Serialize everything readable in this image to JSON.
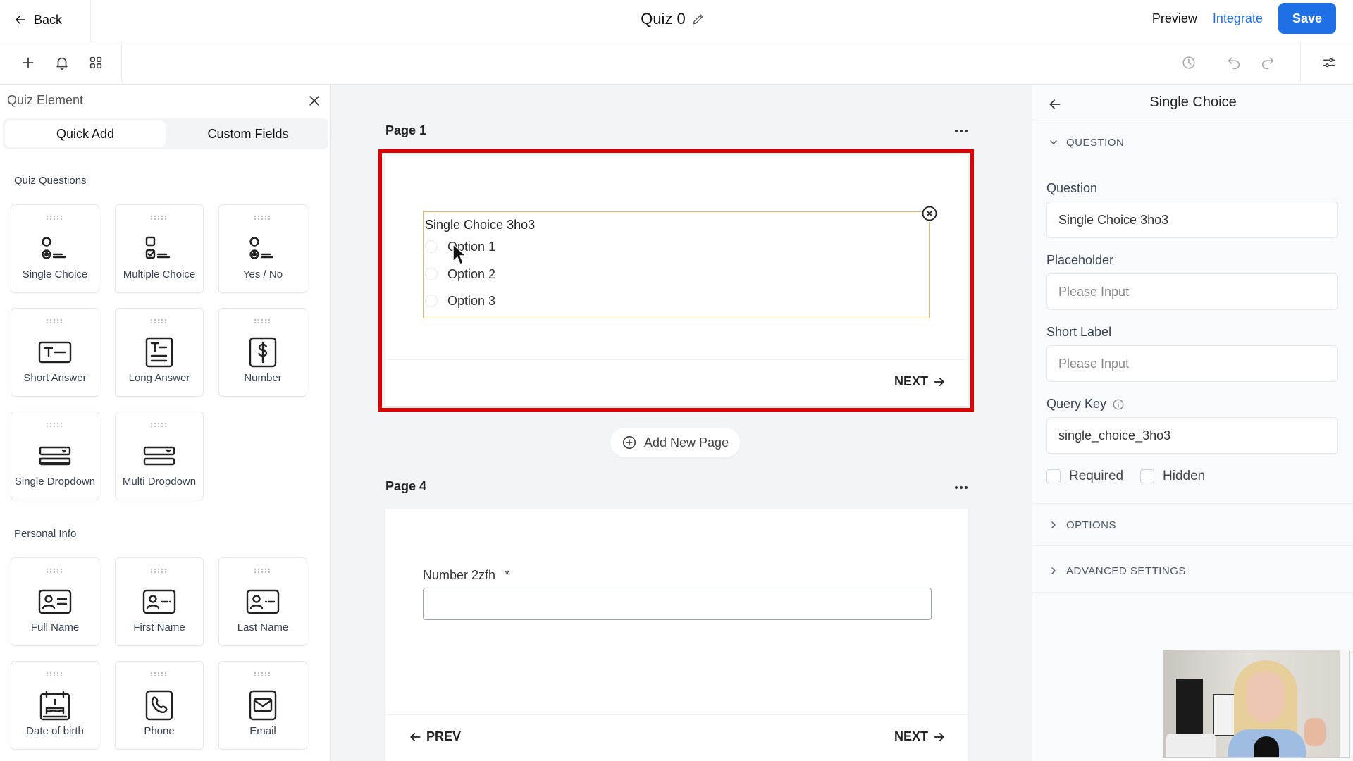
{
  "header": {
    "back_label": "Back",
    "title": "Quiz 0",
    "preview_label": "Preview",
    "integrate_label": "Integrate",
    "save_label": "Save"
  },
  "toolbar": {
    "left_icons": [
      "plus-icon",
      "bell-icon",
      "grid-icon"
    ],
    "right_icons": [
      "history-icon",
      "undo-icon",
      "redo-icon",
      "settings-sliders-icon"
    ]
  },
  "left_panel": {
    "title": "Quiz Element",
    "tabs": [
      {
        "label": "Quick Add",
        "active": true
      },
      {
        "label": "Custom Fields",
        "active": false
      }
    ],
    "sections": [
      {
        "label": "Quiz Questions",
        "items": [
          {
            "label": "Single Choice",
            "icon": "single-choice-icon"
          },
          {
            "label": "Multiple Choice",
            "icon": "multiple-choice-icon"
          },
          {
            "label": "Yes / No",
            "icon": "yes-no-icon"
          },
          {
            "label": "Short Answer",
            "icon": "short-answer-icon"
          },
          {
            "label": "Long Answer",
            "icon": "long-answer-icon"
          },
          {
            "label": "Number",
            "icon": "dollar-icon"
          },
          {
            "label": "Single Dropdown",
            "icon": "dropdown-icon"
          },
          {
            "label": "Multi Dropdown",
            "icon": "dropdown-icon"
          }
        ]
      },
      {
        "label": "Personal Info",
        "items": [
          {
            "label": "Full Name",
            "icon": "id-card-icon"
          },
          {
            "label": "First Name",
            "icon": "id-card-icon"
          },
          {
            "label": "Last Name",
            "icon": "id-card-icon"
          },
          {
            "label": "Date of birth",
            "icon": "cake-icon"
          },
          {
            "label": "Phone",
            "icon": "phone-icon"
          },
          {
            "label": "Email",
            "icon": "email-icon"
          }
        ]
      }
    ]
  },
  "canvas": {
    "page1": {
      "label": "Page 1",
      "question": {
        "title": "Single Choice 3ho3",
        "options": [
          "Option 1",
          "Option 2",
          "Option 3"
        ]
      },
      "next_label": "NEXT"
    },
    "add_page_label": "Add New Page",
    "page4": {
      "label": "Page 4",
      "field_label": "Number 2zfh",
      "required_mark": "*",
      "prev_label": "PREV",
      "next_label": "NEXT"
    }
  },
  "right_panel": {
    "title": "Single Choice",
    "question_section": "QUESTION",
    "question_label": "Question",
    "question_value": "Single Choice 3ho3",
    "placeholder_label": "Placeholder",
    "placeholder_placeholder": "Please Input",
    "short_label_label": "Short Label",
    "short_label_placeholder": "Please Input",
    "query_key_label": "Query Key",
    "query_key_value": "single_choice_3ho3",
    "required_label": "Required",
    "hidden_label": "Hidden",
    "options_section": "OPTIONS",
    "advanced_section": "ADVANCED SETTINGS"
  },
  "colors": {
    "accent": "#1f6fe5",
    "selection_outline": "#e00000",
    "element_border": "#e6b86b"
  }
}
